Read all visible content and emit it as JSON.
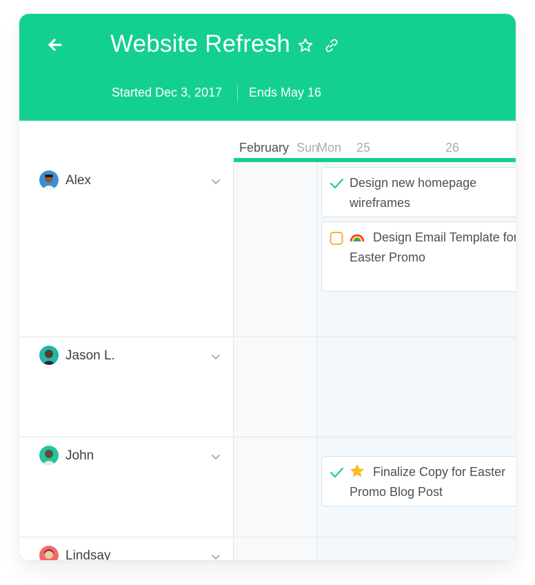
{
  "project": {
    "title": "Website Refresh",
    "started": "Started Dec 3, 2017",
    "ends": "Ends May 16",
    "accent": "#13d08e"
  },
  "timeline": {
    "month": "February",
    "day_sun": "Sun",
    "day_mon": "Mon",
    "dates": [
      "25",
      "26"
    ]
  },
  "icons": {
    "back": "back-arrow-icon",
    "favorite": "star-outline-icon",
    "copy_link": "link-icon",
    "expand": "chevron-down-icon",
    "done": "checkmark-icon",
    "todo": "empty-checkbox-icon"
  },
  "people": [
    {
      "name": "Alex",
      "avatar_color": "#3b8fd9"
    },
    {
      "name": "Jason L.",
      "avatar_color": "#22b5a8"
    },
    {
      "name": "John",
      "avatar_color": "#1fc7a0"
    },
    {
      "name": "Lindsay",
      "avatar_color": "#f26b6b"
    }
  ],
  "tasks": [
    {
      "text": "Design new homepage wireframes",
      "status": "done",
      "emoji": ""
    },
    {
      "text": "Design Email Template for Easter Promo",
      "status": "todo",
      "emoji": "rainbow"
    },
    {
      "text": "Finalize Copy for Easter Promo Blog Post",
      "status": "done",
      "emoji": "star"
    }
  ]
}
